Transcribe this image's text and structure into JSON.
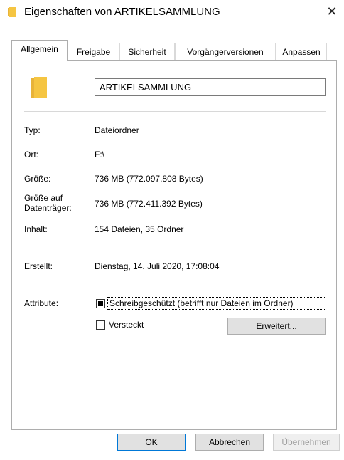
{
  "window": {
    "title": "Eigenschaften von ARTIKELSAMMLUNG"
  },
  "tabs": [
    {
      "label": "Allgemein"
    },
    {
      "label": "Freigabe"
    },
    {
      "label": "Sicherheit"
    },
    {
      "label": "Vorgängerversionen"
    },
    {
      "label": "Anpassen"
    }
  ],
  "general": {
    "folder_name": "ARTIKELSAMMLUNG",
    "type_label": "Typ:",
    "type_value": "Dateiordner",
    "location_label": "Ort:",
    "location_value": "F:\\",
    "size_label": "Größe:",
    "size_value": "736 MB (772.097.808 Bytes)",
    "size_on_disk_label_1": "Größe auf",
    "size_on_disk_label_2": "Datenträger:",
    "size_on_disk_value": "736 MB (772.411.392 Bytes)",
    "contents_label": "Inhalt:",
    "contents_value": "154 Dateien, 35 Ordner",
    "created_label": "Erstellt:",
    "created_value": "Dienstag, 14. Juli 2020, 17:08:04",
    "attributes_label": "Attribute:",
    "readonly_label": "Schreibgeschützt (betrifft nur Dateien im Ordner)",
    "hidden_label": "Versteckt",
    "advanced_button": "Erweitert..."
  },
  "buttons": {
    "ok": "OK",
    "cancel": "Abbrechen",
    "apply": "Übernehmen"
  },
  "icons": {
    "title": "folder-icon",
    "large": "folder-icon"
  },
  "colors": {
    "folder": "#f5c542",
    "accent": "#0078d7"
  }
}
